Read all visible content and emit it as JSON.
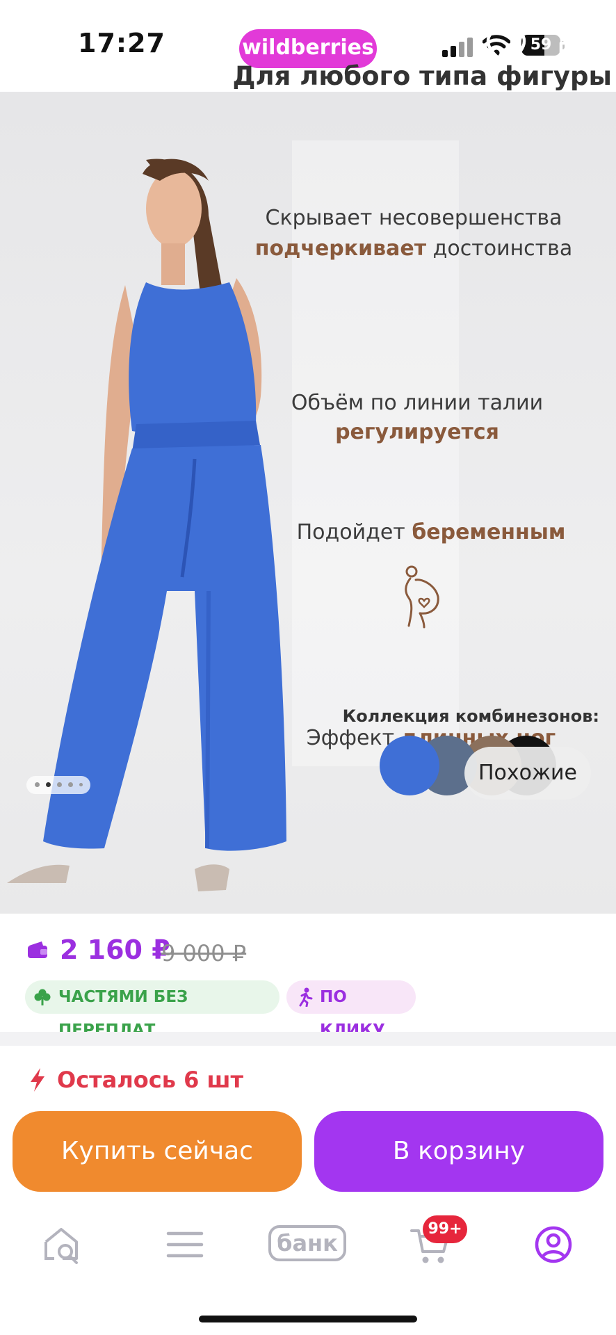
{
  "status_bar": {
    "time": "17:27",
    "brand": "wildberries",
    "battery": "59"
  },
  "hero": {
    "title": "Для любого типа фигуры",
    "line1": "Скрывает несовершенства",
    "line2_accent": "подчеркивает",
    "line2_rest": " достоинства",
    "waist_line1": "Объём по линии талии",
    "waist_accent": "регулируется",
    "pregnant_plain": "Подойдет ",
    "pregnant_accent": "беременным",
    "legs_plain": "Эффект ",
    "legs_accent": "длинных ног",
    "collection_title": "Коллекция комбинезонов:",
    "swatch_colors": [
      "#3f6fd6",
      "#5c6f8c",
      "#8b705c",
      "#111111"
    ],
    "similar_label": "Похожие",
    "image_index": 2,
    "image_count": 5
  },
  "price": {
    "current": "2 160 ₽",
    "old": "9 000 ₽",
    "badge_installments": "ЧАСТЯМИ БЕЗ ПЕРЕПЛАТ",
    "badge_click": "ПО КЛИКУ"
  },
  "stock": {
    "text": "Осталось 6 шт"
  },
  "actions": {
    "buy_now": "Купить сейчас",
    "add_to_cart": "В корзину"
  },
  "bottom_nav": {
    "items": [
      "home-search",
      "catalog",
      "bank",
      "cart",
      "profile"
    ],
    "bank_label": "банк",
    "cart_badge": "99+"
  },
  "colors": {
    "accent": "#a336f0",
    "buy": "#f08a2e",
    "price": "#9b2fe0",
    "stock": "#e0394b",
    "brand": "#e23ad8"
  }
}
